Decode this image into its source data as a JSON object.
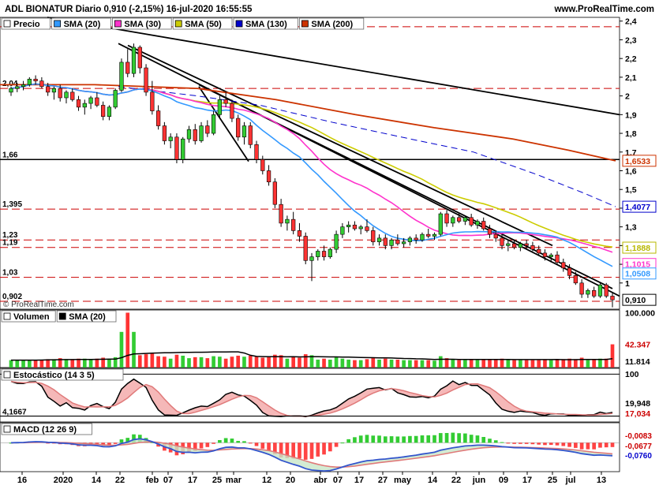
{
  "header": {
    "title": "ADL BIONATUR Diario 0,910 (-2,15%) 16-jul-2020 16:55:55",
    "site": "www.ProRealTime.com",
    "watermark": "© ProRealTime.com"
  },
  "legend_price": [
    {
      "label": "Precio",
      "color": "#ffffff"
    },
    {
      "label": "SMA (20)",
      "color": "#3399ff"
    },
    {
      "label": "SMA (30)",
      "color": "#ff33cc"
    },
    {
      "label": "SMA (50)",
      "color": "#cccc00"
    },
    {
      "label": "SMA (130)",
      "color": "#0000cc"
    },
    {
      "label": "SMA (200)",
      "color": "#cc3300"
    }
  ],
  "legend_volume": [
    {
      "label": "Volumen",
      "color": "#ffffff"
    },
    {
      "label": "SMA (20)",
      "color": "#000000"
    }
  ],
  "legend_stoch": [
    {
      "label": "Estocástico (14 3 5)",
      "color": "#ffffff"
    }
  ],
  "legend_macd": [
    {
      "label": "MACD (12 26 9)",
      "color": "#ffffff"
    }
  ],
  "chart_data": {
    "type": "candlestick",
    "price_axis": {
      "ylim": [
        0.86,
        2.42
      ],
      "ticks": [
        "2,4",
        "2,3",
        "2,2",
        "2,1",
        "2",
        "1,9",
        "1,8",
        "1,7",
        "1,6",
        "1,5",
        "1,4",
        "1,3",
        "1,2",
        "1,1",
        "1"
      ]
    },
    "level_labels": [
      "2,04",
      "1,66",
      "1,395",
      "1,23",
      "1,19",
      "1,03",
      "0,902"
    ],
    "levels_dashed": [
      2.37,
      2.04,
      1.395,
      1.23,
      1.19,
      1.03,
      0.902
    ],
    "level_solid": 1.66,
    "badges": [
      {
        "text": "1,6533",
        "color": "#cc3300",
        "value": 1.6533
      },
      {
        "text": "1,4077",
        "color": "#0000cc",
        "value": 1.4077
      },
      {
        "text": "1,1888",
        "color": "#b8b800",
        "value": 1.1888
      },
      {
        "text": "1,1015",
        "color": "#ff33cc",
        "value": 1.1015
      },
      {
        "text": "1,0508",
        "color": "#3399ff",
        "value": 1.0508
      },
      {
        "text": "0,910",
        "color": "#000000",
        "value": 0.91
      }
    ],
    "x_labels": [
      "16",
      "2020",
      "14",
      "22",
      "feb",
      "07",
      "17",
      "25",
      "mar",
      "12",
      "20",
      "abr",
      "07",
      "17",
      "27",
      "may",
      "14",
      "22",
      "jun",
      "09",
      "17",
      "25",
      "jul",
      "13"
    ],
    "candles": [
      [
        2.02,
        2.05,
        2.0,
        2.04
      ],
      [
        2.04,
        2.07,
        2.02,
        2.05
      ],
      [
        2.05,
        2.08,
        2.03,
        2.06
      ],
      [
        2.06,
        2.1,
        2.05,
        2.09
      ],
      [
        2.09,
        2.11,
        2.06,
        2.08
      ],
      [
        2.08,
        2.1,
        2.04,
        2.05
      ],
      [
        2.05,
        2.07,
        2.0,
        2.02
      ],
      [
        2.02,
        2.05,
        1.98,
        2.04
      ],
      [
        2.04,
        2.06,
        1.97,
        1.99
      ],
      [
        1.99,
        2.03,
        1.96,
        2.02
      ],
      [
        2.02,
        2.04,
        1.97,
        1.98
      ],
      [
        1.98,
        2.0,
        1.92,
        1.94
      ],
      [
        1.94,
        1.98,
        1.9,
        1.96
      ],
      [
        1.96,
        2.0,
        1.93,
        1.99
      ],
      [
        1.99,
        2.02,
        1.94,
        1.95
      ],
      [
        1.95,
        1.97,
        1.87,
        1.89
      ],
      [
        1.89,
        1.95,
        1.87,
        1.94
      ],
      [
        1.94,
        2.04,
        1.93,
        2.03
      ],
      [
        2.03,
        2.2,
        2.02,
        2.18
      ],
      [
        2.18,
        2.25,
        2.1,
        2.12
      ],
      [
        2.12,
        2.28,
        2.1,
        2.26
      ],
      [
        2.26,
        2.27,
        2.12,
        2.15
      ],
      [
        2.15,
        2.17,
        2.0,
        2.02
      ],
      [
        2.02,
        2.08,
        1.9,
        1.92
      ],
      [
        1.92,
        1.95,
        1.82,
        1.84
      ],
      [
        1.84,
        1.86,
        1.74,
        1.76
      ],
      [
        1.76,
        1.8,
        1.72,
        1.78
      ],
      [
        1.78,
        1.8,
        1.64,
        1.66
      ],
      [
        1.66,
        1.78,
        1.64,
        1.77
      ],
      [
        1.77,
        1.84,
        1.75,
        1.82
      ],
      [
        1.82,
        1.85,
        1.74,
        1.76
      ],
      [
        1.76,
        1.86,
        1.75,
        1.84
      ],
      [
        1.84,
        1.87,
        1.78,
        1.8
      ],
      [
        1.8,
        1.92,
        1.79,
        1.9
      ],
      [
        1.9,
        2.0,
        1.88,
        1.98
      ],
      [
        1.98,
        2.02,
        1.94,
        1.96
      ],
      [
        1.96,
        1.98,
        1.86,
        1.88
      ],
      [
        1.88,
        1.9,
        1.76,
        1.78
      ],
      [
        1.78,
        1.86,
        1.74,
        1.84
      ],
      [
        1.84,
        1.86,
        1.72,
        1.74
      ],
      [
        1.74,
        1.76,
        1.64,
        1.66
      ],
      [
        1.66,
        1.68,
        1.58,
        1.6
      ],
      [
        1.6,
        1.63,
        1.52,
        1.54
      ],
      [
        1.54,
        1.56,
        1.4,
        1.42
      ],
      [
        1.42,
        1.45,
        1.3,
        1.32
      ],
      [
        1.32,
        1.36,
        1.28,
        1.34
      ],
      [
        1.34,
        1.38,
        1.26,
        1.28
      ],
      [
        1.28,
        1.32,
        1.22,
        1.25
      ],
      [
        1.25,
        1.27,
        1.1,
        1.12
      ],
      [
        1.12,
        1.16,
        1.01,
        1.14
      ],
      [
        1.14,
        1.18,
        1.12,
        1.17
      ],
      [
        1.17,
        1.2,
        1.12,
        1.14
      ],
      [
        1.14,
        1.19,
        1.13,
        1.18
      ],
      [
        1.18,
        1.28,
        1.16,
        1.26
      ],
      [
        1.26,
        1.32,
        1.24,
        1.3
      ],
      [
        1.3,
        1.33,
        1.27,
        1.31
      ],
      [
        1.31,
        1.33,
        1.28,
        1.29
      ],
      [
        1.29,
        1.31,
        1.26,
        1.3
      ],
      [
        1.3,
        1.34,
        1.27,
        1.28
      ],
      [
        1.28,
        1.3,
        1.2,
        1.22
      ],
      [
        1.22,
        1.26,
        1.2,
        1.24
      ],
      [
        1.24,
        1.26,
        1.18,
        1.2
      ],
      [
        1.2,
        1.24,
        1.18,
        1.23
      ],
      [
        1.23,
        1.26,
        1.2,
        1.21
      ],
      [
        1.21,
        1.24,
        1.19,
        1.22
      ],
      [
        1.22,
        1.25,
        1.2,
        1.24
      ],
      [
        1.24,
        1.26,
        1.21,
        1.23
      ],
      [
        1.23,
        1.27,
        1.22,
        1.26
      ],
      [
        1.26,
        1.29,
        1.24,
        1.25
      ],
      [
        1.25,
        1.27,
        1.23,
        1.26
      ],
      [
        1.26,
        1.38,
        1.25,
        1.37
      ],
      [
        1.37,
        1.39,
        1.3,
        1.32
      ],
      [
        1.32,
        1.36,
        1.3,
        1.35
      ],
      [
        1.35,
        1.37,
        1.32,
        1.33
      ],
      [
        1.33,
        1.36,
        1.31,
        1.35
      ],
      [
        1.35,
        1.37,
        1.3,
        1.31
      ],
      [
        1.31,
        1.34,
        1.29,
        1.33
      ],
      [
        1.33,
        1.35,
        1.28,
        1.29
      ],
      [
        1.29,
        1.31,
        1.24,
        1.26
      ],
      [
        1.26,
        1.28,
        1.22,
        1.24
      ],
      [
        1.24,
        1.26,
        1.18,
        1.2
      ],
      [
        1.2,
        1.23,
        1.17,
        1.21
      ],
      [
        1.21,
        1.23,
        1.18,
        1.19
      ],
      [
        1.19,
        1.22,
        1.17,
        1.21
      ],
      [
        1.21,
        1.23,
        1.18,
        1.2
      ],
      [
        1.2,
        1.22,
        1.17,
        1.18
      ],
      [
        1.18,
        1.2,
        1.15,
        1.16
      ],
      [
        1.16,
        1.18,
        1.12,
        1.14
      ],
      [
        1.14,
        1.16,
        1.11,
        1.15
      ],
      [
        1.15,
        1.17,
        1.1,
        1.11
      ],
      [
        1.11,
        1.13,
        1.06,
        1.08
      ],
      [
        1.08,
        1.1,
        1.02,
        1.04
      ],
      [
        1.04,
        1.06,
        0.99,
        1.0
      ],
      [
        1.0,
        1.02,
        0.92,
        0.94
      ],
      [
        0.94,
        0.97,
        0.92,
        0.96
      ],
      [
        0.96,
        0.98,
        0.92,
        0.93
      ],
      [
        0.93,
        1.0,
        0.92,
        0.99
      ],
      [
        0.99,
        1.0,
        0.92,
        0.93
      ],
      [
        0.93,
        0.95,
        0.87,
        0.91
      ]
    ],
    "volume": {
      "axis_labels": [
        "100.000",
        "42.347",
        "11.814"
      ],
      "ymax": 105000,
      "last": 42347,
      "sma_last": 11814
    },
    "stochastic": {
      "axis_labels": [
        "100",
        "19,948",
        "17,034"
      ],
      "level_label": "4,1667",
      "k_last": 19.948,
      "d_last": 17.034
    },
    "macd": {
      "axis_labels": [
        "-0,0083",
        "-0,0677",
        "-0,0760"
      ],
      "hist_last": -0.0083,
      "macd_last": -0.0677,
      "signal_last": -0.076
    }
  }
}
